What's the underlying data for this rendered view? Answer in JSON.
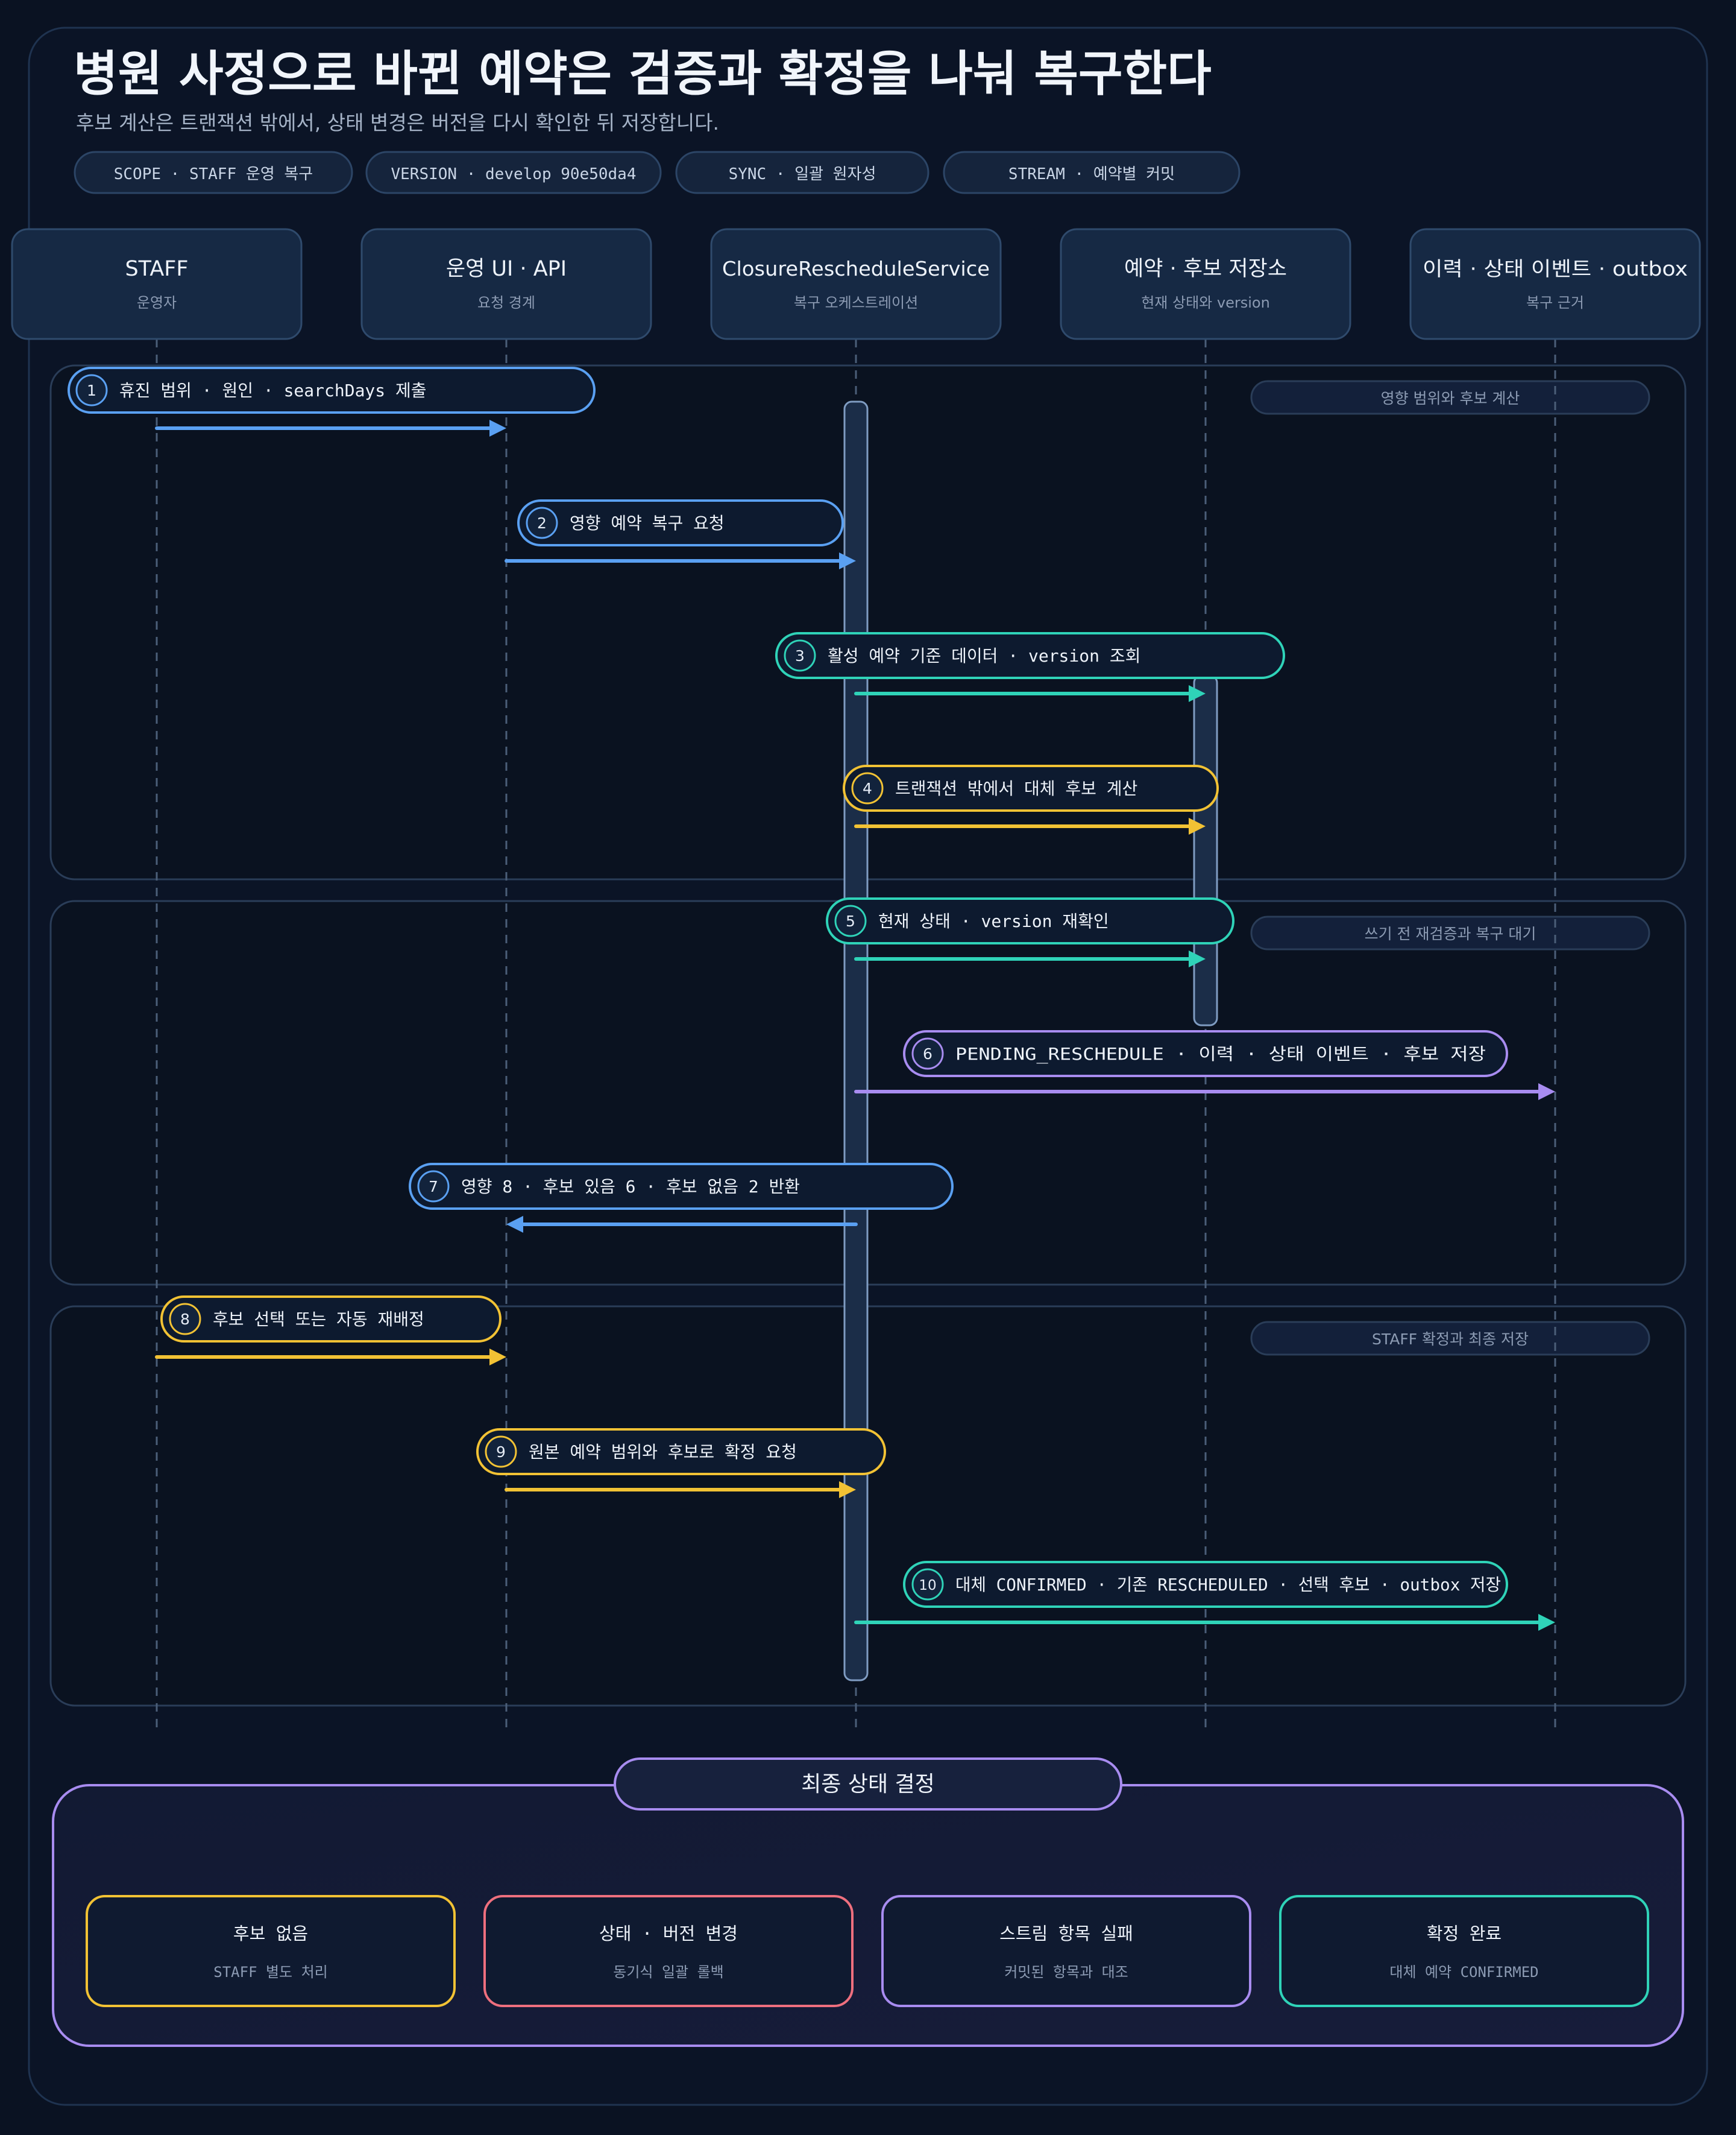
{
  "title": "병원 사정으로 바뀐 예약은 검증과 확정을 나눠 복구한다",
  "subtitle": "후보 계산은 트랜잭션 밖에서, 상태 변경은 버전을 다시 확인한 뒤 저장합니다.",
  "chips": [
    {
      "label": "SCOPE · STAFF 운영 복구"
    },
    {
      "label": "VERSION · develop 90e50da4"
    },
    {
      "label": "SYNC · 일괄 원자성"
    },
    {
      "label": "STREAM · 예약별 커밋"
    }
  ],
  "participants": [
    {
      "name": "STAFF",
      "role": "운영자"
    },
    {
      "name": "운영 UI · API",
      "role": "요청 경계"
    },
    {
      "name": "ClosureRescheduleService",
      "role": "복구 오케스트레이션"
    },
    {
      "name": "예약 · 후보 저장소",
      "role": "현재 상태와 version"
    },
    {
      "name": "이력 · 상태 이벤트 · outbox",
      "role": "복구 근거"
    }
  ],
  "phases": [
    {
      "label": "영향 범위와 후보 계산"
    },
    {
      "label": "쓰기 전 재검증과 복구 대기"
    },
    {
      "label": "STAFF 확정과 최종 저장"
    }
  ],
  "steps": [
    {
      "num": "1",
      "label": "휴진 범위 · 원인 · searchDays 제출",
      "from": 0,
      "to": 1,
      "color": "blue"
    },
    {
      "num": "2",
      "label": "영향 예약 복구 요청",
      "from": 1,
      "to": 2,
      "color": "blue"
    },
    {
      "num": "3",
      "label": "활성 예약 기준 데이터 · version 조회",
      "from": 2,
      "to": 3,
      "color": "teal"
    },
    {
      "num": "4",
      "label": "트랜잭션 밖에서 대체 후보 계산",
      "from": 2,
      "to": 3,
      "color": "yellow"
    },
    {
      "num": "5",
      "label": "현재 상태 · version 재확인",
      "from": 2,
      "to": 3,
      "color": "teal"
    },
    {
      "num": "6",
      "label": "PENDING_RESCHEDULE · 이력 · 상태 이벤트 · 후보 저장",
      "from": 2,
      "to": 4,
      "color": "purple"
    },
    {
      "num": "7",
      "label": "영향 8 · 후보 있음 6 · 후보 없음 2 반환",
      "from": 2,
      "to": 1,
      "color": "blue"
    },
    {
      "num": "8",
      "label": "후보 선택 또는 자동 재배정",
      "from": 0,
      "to": 1,
      "color": "yellow"
    },
    {
      "num": "9",
      "label": "원본 예약 범위와 후보로 확정 요청",
      "from": 1,
      "to": 2,
      "color": "yellow"
    },
    {
      "num": "10",
      "label": "대체 CONFIRMED · 기존 RESCHEDULED · 선택 후보 · outbox 저장",
      "from": 2,
      "to": 4,
      "color": "teal"
    }
  ],
  "final": {
    "title": "최종 상태 결정",
    "cards": [
      {
        "title": "후보 없음",
        "sub": "STAFF 별도 처리",
        "color": "yellow"
      },
      {
        "title": "상태 · 버전 변경",
        "sub": "동기식 일괄 롤백",
        "color": "red"
      },
      {
        "title": "스트림 항목 실패",
        "sub": "커밋된 항목과 대조",
        "color": "purple"
      },
      {
        "title": "확정 완료",
        "sub": "대체 예약 CONFIRMED",
        "color": "teal"
      }
    ]
  },
  "colors": {
    "blue": "#5aa0f2",
    "teal": "#2fd3b8",
    "yellow": "#f2c234",
    "purple": "#a88cf0",
    "red": "#ee6f7e"
  }
}
